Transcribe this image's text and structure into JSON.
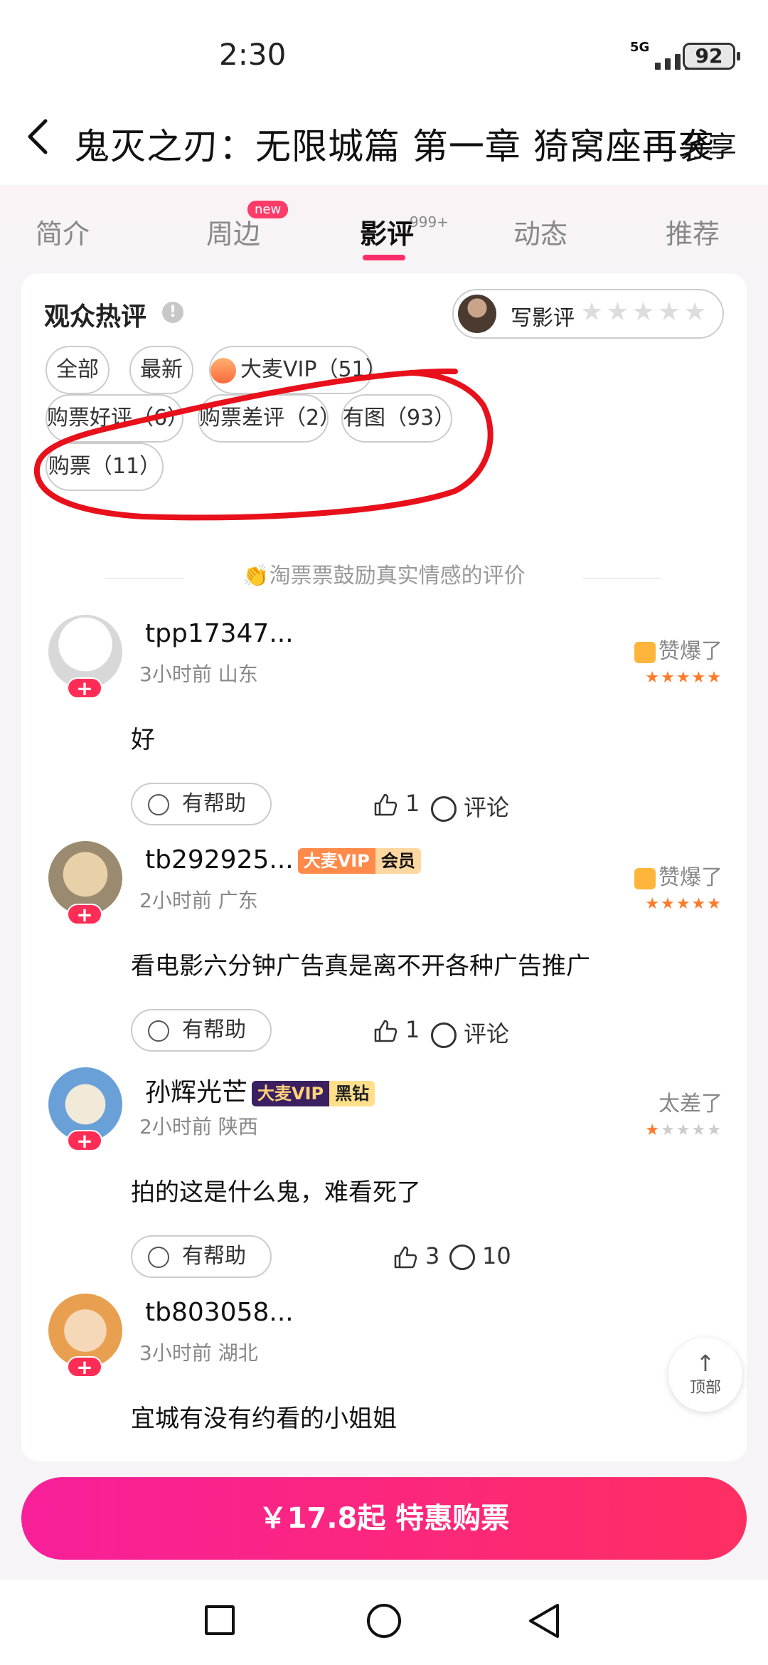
{
  "status": {
    "time": "2:30",
    "network": "5G",
    "battery": "92"
  },
  "header": {
    "title": "鬼灭之刃：无限城篇 第一章 猗窝座再袭",
    "share": "分享"
  },
  "tabs": [
    {
      "label": "简介"
    },
    {
      "label": "周边",
      "badge": "new"
    },
    {
      "label": "影评",
      "sup": "999+"
    },
    {
      "label": "动态"
    },
    {
      "label": "推荐"
    }
  ],
  "section": {
    "title": "观众热评",
    "info": "!",
    "write_label": "写影评",
    "write_stars": "★★★★★"
  },
  "filters": {
    "all": "全部",
    "latest": "最新",
    "vip": "大麦VIP（51）",
    "good": "购票好评（6）",
    "bad": "购票差评（2）",
    "pics": "有图（93）",
    "bought": "购票（11）"
  },
  "hint": "👏淘票票鼓励真实情感的评价",
  "reviews": [
    {
      "user": "tpp17347...",
      "meta": "3小时前 山东",
      "rating": "赞爆了",
      "stars_on": "★★★★★",
      "stars_off": "",
      "content": "好",
      "helpful": "有帮助",
      "likes": "1",
      "comments": "评论"
    },
    {
      "user": "tb292925...",
      "vip1": "大麦VIP",
      "vip2": "会员",
      "meta": "2小时前 广东",
      "rating": "赞爆了",
      "stars_on": "★★★★★",
      "stars_off": "",
      "content": "看电影六分钟广告真是离不开各种广告推广",
      "helpful": "有帮助",
      "likes": "1",
      "comments": "评论"
    },
    {
      "user": "孙辉光芒",
      "vip1": "大麦VIP",
      "vip2": "黑钻",
      "meta": "2小时前 陕西",
      "rating": "太差了",
      "stars_on": "★",
      "stars_off": "★★★★",
      "content": "拍的这是什么鬼，难看死了",
      "helpful": "有帮助",
      "likes": "3",
      "comments": "10"
    },
    {
      "user": "tb803058...",
      "meta": "3小时前 湖北",
      "content": "宜城有没有约看的小姐姐"
    }
  ],
  "to_top": "顶部",
  "buy_button": "￥17.8起 特惠购票",
  "colors": {
    "accent": "#ff2c6a",
    "buy_start": "#f81f9a",
    "buy_end": "#ff2e62",
    "stars": "#ff7a2a",
    "annotation": "#e8101a"
  }
}
